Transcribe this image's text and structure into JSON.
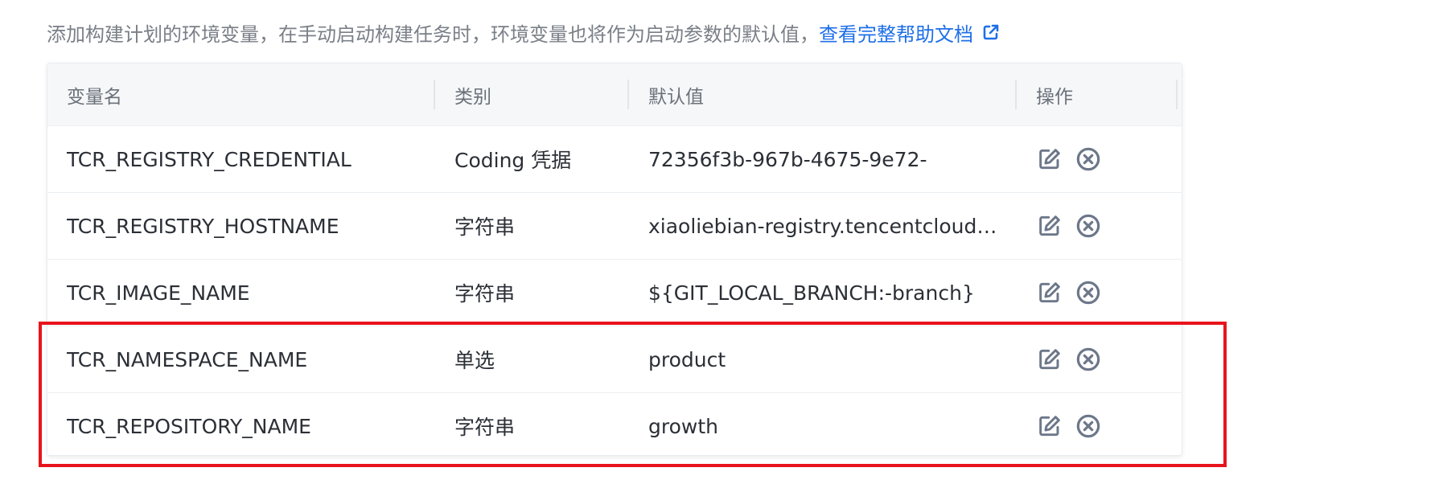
{
  "description": {
    "text": "添加构建计划的环境变量，在手动启动构建任务时，环境变量也将作为启动参数的默认值，",
    "help_link": "查看完整帮助文档"
  },
  "table": {
    "headers": {
      "name": "变量名",
      "type": "类别",
      "default": "默认值",
      "actions": "操作"
    },
    "rows": [
      {
        "name": "TCR_REGISTRY_CREDENTIAL",
        "type": "Coding 凭据",
        "default": "72356f3b-967b-4675-9e72-"
      },
      {
        "name": "TCR_REGISTRY_HOSTNAME",
        "type": "字符串",
        "default": "xiaoliebian-registry.tencentcloudcr.com"
      },
      {
        "name": "TCR_IMAGE_NAME",
        "type": "字符串",
        "default": "${GIT_LOCAL_BRANCH:-branch}"
      },
      {
        "name": "TCR_NAMESPACE_NAME",
        "type": "单选",
        "default": "product"
      },
      {
        "name": "TCR_REPOSITORY_NAME",
        "type": "字符串",
        "default": "growth"
      }
    ]
  },
  "icons": {
    "external_link": "external-link-icon",
    "edit": "edit-icon",
    "delete": "delete-circle-icon"
  },
  "colors": {
    "link": "#1e6fe8",
    "icon": "#6c7789",
    "highlight": "#e8141c"
  }
}
